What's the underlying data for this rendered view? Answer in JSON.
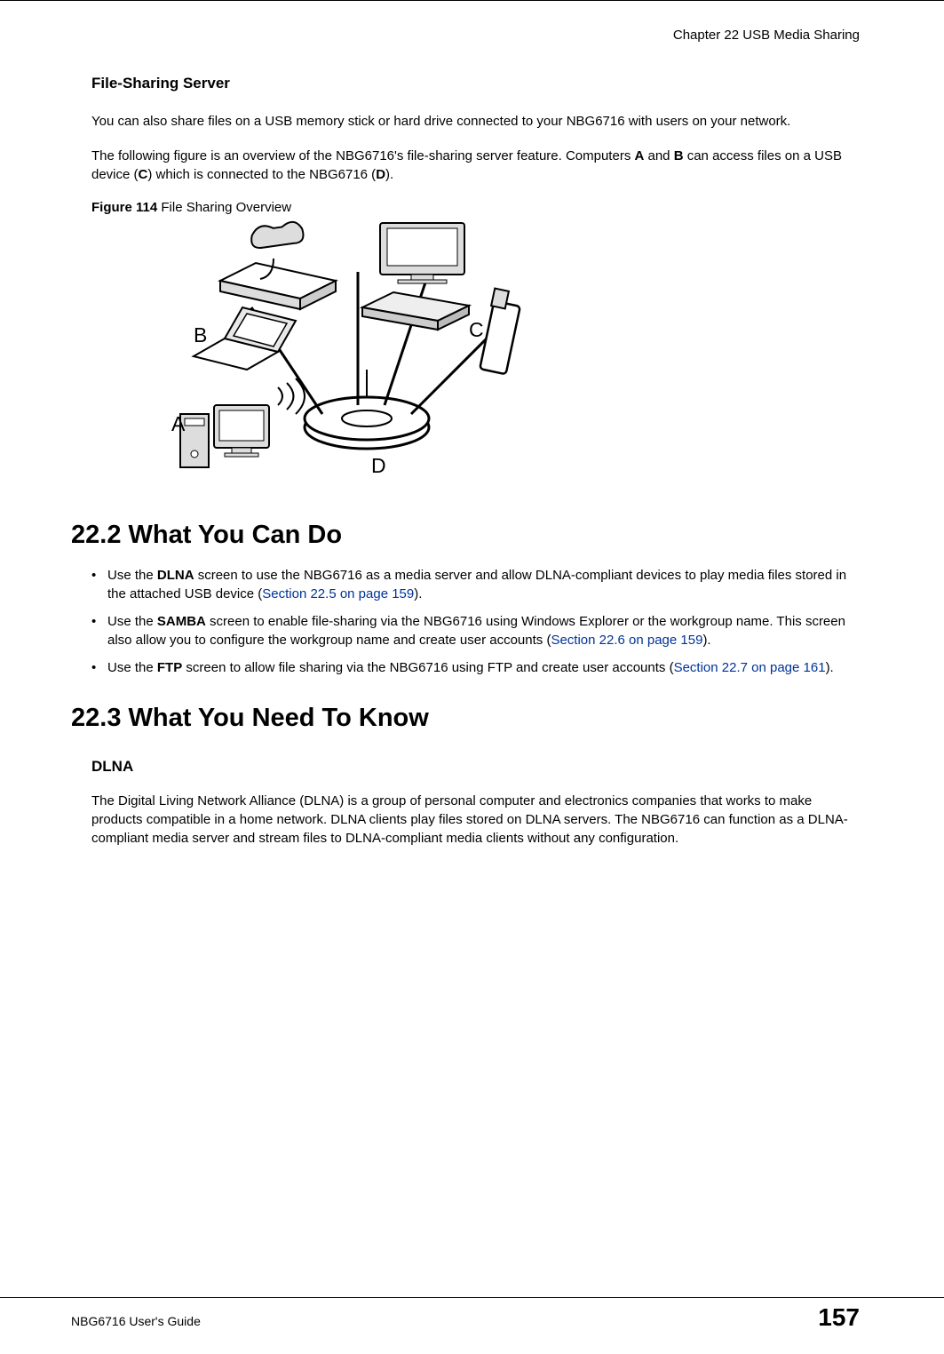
{
  "header": {
    "chapter": "Chapter 22 USB Media Sharing"
  },
  "fs": {
    "title": "File-Sharing Server",
    "p1a": "You can also share files on a USB memory stick or hard drive connected to your NBG6716 with users on your network.",
    "p2a": "The following figure is an overview of the NBG6716's file-sharing server feature. Computers ",
    "p2_A": "A",
    "p2b": " and ",
    "p2_B": "B",
    "p2c": " can access files on a USB device (",
    "p2_C": "C",
    "p2d": ") which is connected to the NBG6716 (",
    "p2_D": "D",
    "p2e": ")."
  },
  "fig": {
    "num": "Figure 114",
    "title": "   File Sharing Overview",
    "labelA": "A",
    "labelB": "B",
    "labelC": "C",
    "labelD": "D"
  },
  "s22_2": {
    "heading": "22.2  What You Can Do",
    "b1a": "Use the ",
    "b1_bold": "DLNA",
    "b1b": " screen to use the NBG6716 as a media server and allow DLNA-compliant devices to play media files stored in the attached USB device (",
    "b1_link": "Section 22.5 on page 159",
    "b1c": ").",
    "b2a": "Use the ",
    "b2_bold": "SAMBA",
    "b2b": " screen to enable file-sharing via the NBG6716 using Windows Explorer or the workgroup name. This screen also allow you to configure the workgroup name and create user accounts (",
    "b2_link": "Section 22.6 on page 159",
    "b2c": ").",
    "b3a": "Use the ",
    "b3_bold": "FTP",
    "b3b": " screen to allow file sharing via the NBG6716 using FTP and create user accounts (",
    "b3_link": "Section 22.7 on page 161",
    "b3c": ")."
  },
  "s22_3": {
    "heading": "22.3  What You Need To Know",
    "dlna_title": "DLNA",
    "dlna_body": "The Digital Living Network Alliance (DLNA) is a group of personal computer and electronics companies that works to make products compatible in a home network. DLNA clients play files stored on DLNA servers. The NBG6716 can function as a DLNA-compliant media server and stream files to DLNA-compliant media clients without any configuration."
  },
  "footer": {
    "guide": "NBG6716 User's Guide",
    "page": "157"
  }
}
